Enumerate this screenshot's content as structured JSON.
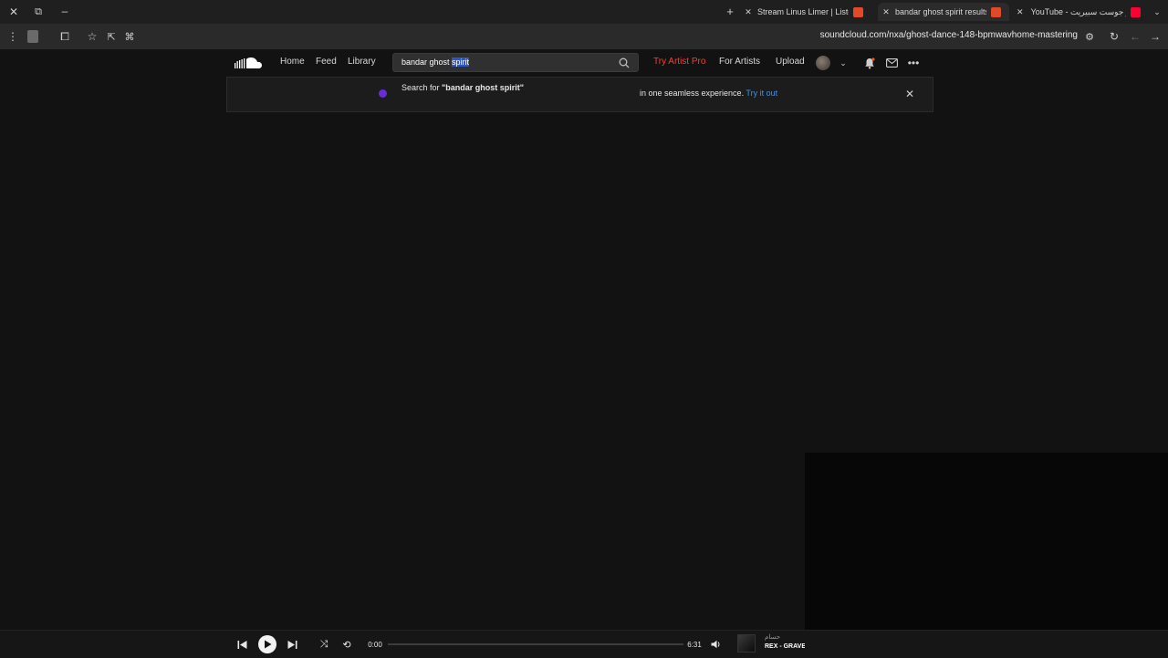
{
  "browser": {
    "tabs": [
      {
        "title": "Stream Linus Limer | Listen to G",
        "favicon_color": "#e04a2a"
      },
      {
        "title": "bandar ghost spirit results on S",
        "favicon_color": "#e04a2a",
        "active": true
      },
      {
        "title": "YouTube - بندر جوست سبيريت",
        "favicon_color": "#ff0033"
      }
    ],
    "url": "soundcloud.com/nxa/ghost-dance-148-bpmwavhome-mastering"
  },
  "header": {
    "nav": {
      "home": "Home",
      "feed": "Feed",
      "library": "Library"
    },
    "search": {
      "value_pre": "bandar ghost ",
      "value_selected": "spirit"
    },
    "try_pro": "Try Artist Pro",
    "for_artists": "For Artists",
    "upload": "Upload"
  },
  "banner": {
    "search_prefix": "Search for ",
    "search_query": "\"bandar ghost spirit\"",
    "experience_text": "in one seamless experience.",
    "try_link": "Try it out"
  },
  "player": {
    "elapsed": "0:00",
    "duration": "6:31",
    "progress": 0,
    "track_artist": "حسام",
    "track_title": "REX - GRAVE"
  },
  "colors": {
    "accent": "#ff5500",
    "pro": "#ff3a2d",
    "link": "#4a8ee6",
    "bg": "#121212"
  }
}
